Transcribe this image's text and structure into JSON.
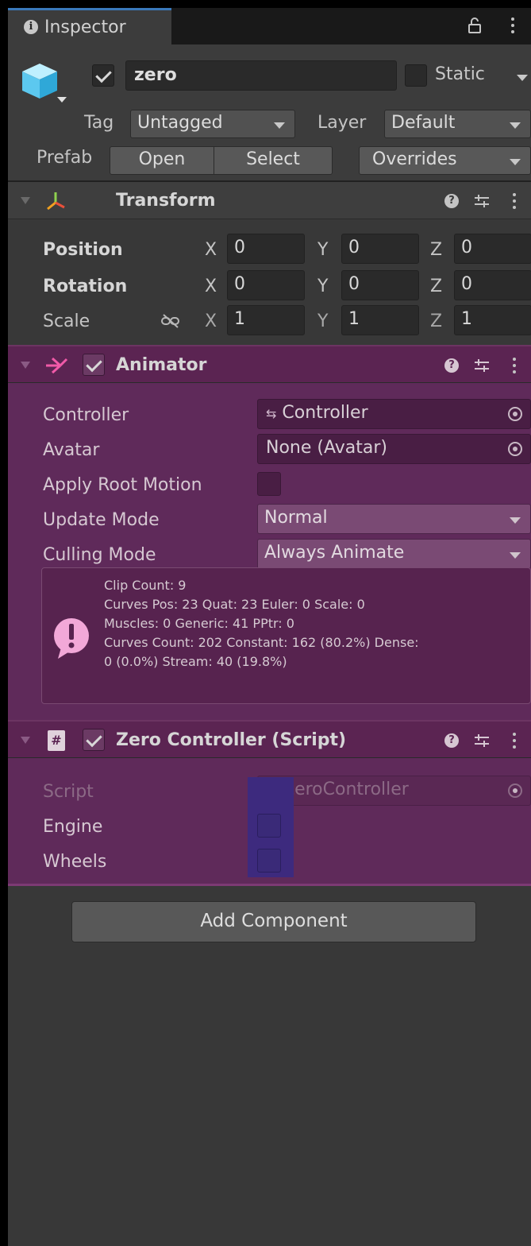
{
  "tab": {
    "label": "Inspector"
  },
  "header": {
    "object_name": "zero",
    "active": true,
    "static_label": "Static",
    "tag_label": "Tag",
    "tag_value": "Untagged",
    "layer_label": "Layer",
    "layer_value": "Default",
    "prefab_label": "Prefab",
    "prefab_open": "Open",
    "prefab_select": "Select",
    "prefab_overrides": "Overrides"
  },
  "transform": {
    "title": "Transform",
    "rows": [
      {
        "label": "Position",
        "x": "0",
        "y": "0",
        "z": "0"
      },
      {
        "label": "Rotation",
        "x": "0",
        "y": "0",
        "z": "0"
      },
      {
        "label": "Scale",
        "x": "1",
        "y": "1",
        "z": "1"
      }
    ],
    "axes": {
      "x": "X",
      "y": "Y",
      "z": "Z"
    }
  },
  "animator": {
    "title": "Animator",
    "enabled": true,
    "controller_label": "Controller",
    "controller_value": "Controller",
    "avatar_label": "Avatar",
    "avatar_value": "None (Avatar)",
    "apply_root_motion_label": "Apply Root Motion",
    "apply_root_motion": false,
    "update_mode_label": "Update Mode",
    "update_mode_value": "Normal",
    "culling_mode_label": "Culling Mode",
    "culling_mode_value": "Always Animate",
    "info_lines": [
      "Clip Count: 9",
      "Curves Pos: 23 Quat: 23 Euler: 0 Scale: 0",
      "Muscles: 0 Generic: 41 PPtr: 0",
      "Curves Count: 202 Constant: 162 (80.2%) Dense:",
      "0 (0.0%) Stream: 40 (19.8%)"
    ]
  },
  "script_component": {
    "title": "Zero Controller (Script)",
    "enabled": true,
    "script_label": "Script",
    "script_value": "ZeroController",
    "engine_label": "Engine",
    "engine": false,
    "wheels_label": "Wheels",
    "wheels": false
  },
  "add_component_label": "Add Component",
  "colors": {
    "panel_bg": "#383838",
    "accent_blue": "#3a79bb",
    "playmode_tint": "#5f2a5a",
    "selection_highlight": "#3d2a7e"
  }
}
